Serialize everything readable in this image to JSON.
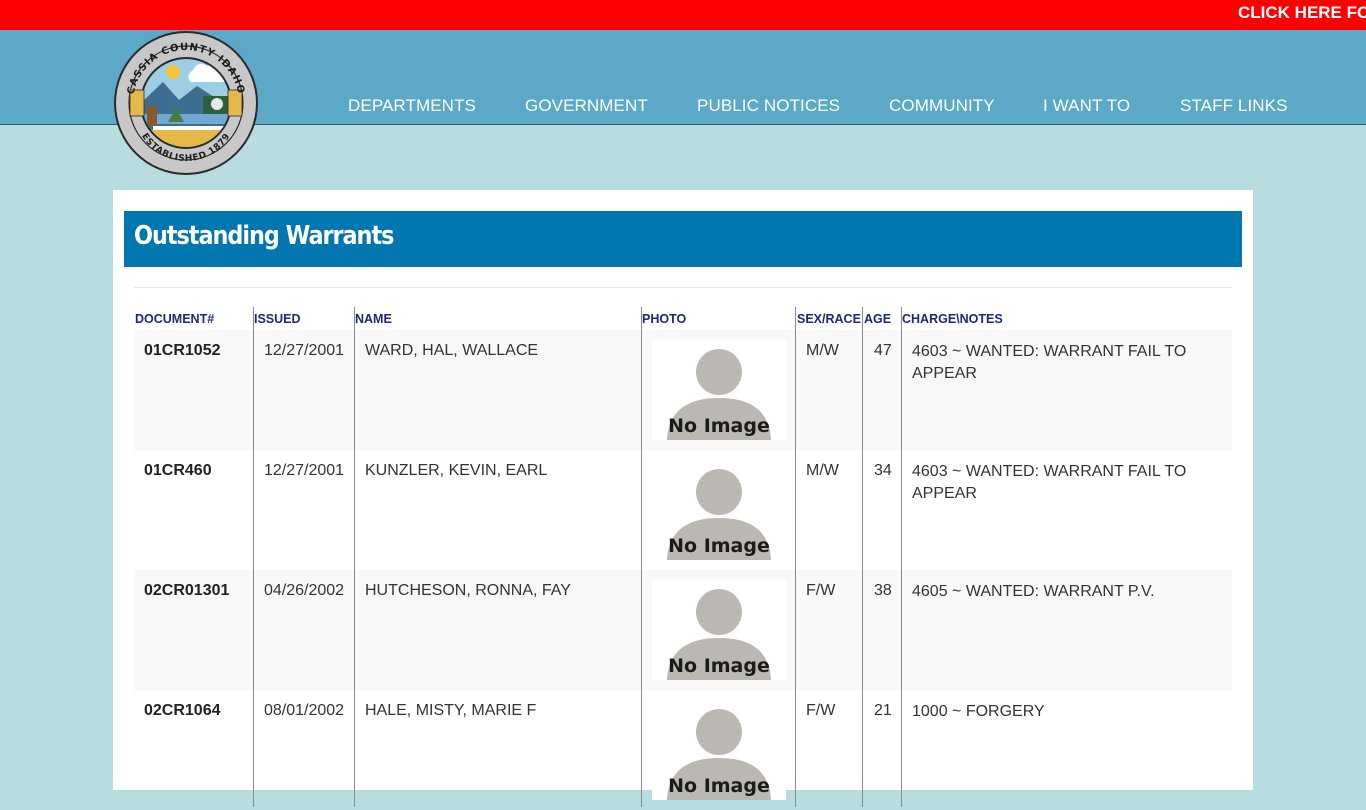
{
  "alert": {
    "text": "CLICK HERE FC"
  },
  "header": {
    "seal": {
      "top": "CASSIA COUNTY IDAHO",
      "bottom": "ESTABLISHED 1879"
    },
    "nav": [
      "DEPARTMENTS",
      "GOVERNMENT",
      "PUBLIC NOTICES",
      "COMMUNITY",
      "I WANT TO",
      "STAFF LINKS"
    ]
  },
  "page": {
    "title": "Outstanding Warrants"
  },
  "table": {
    "columns": [
      "DOCUMENT#",
      "ISSUED",
      "NAME",
      "PHOTO",
      "SEX/RACE",
      "AGE",
      "CHARGE\\NOTES"
    ],
    "photo_placeholder": "No Image",
    "rows": [
      {
        "doc": "01CR1052",
        "issued": "12/27/2001",
        "name": "WARD, HAL, WALLACE",
        "sexrace": "M/W",
        "age": "47",
        "charge": "4603 ~ WANTED: WARRANT FAIL TO APPEAR"
      },
      {
        "doc": "01CR460",
        "issued": "12/27/2001",
        "name": "KUNZLER, KEVIN, EARL",
        "sexrace": "M/W",
        "age": "34",
        "charge": "4603 ~ WANTED: WARRANT FAIL TO APPEAR"
      },
      {
        "doc": "02CR01301",
        "issued": "04/26/2002",
        "name": "HUTCHESON, RONNA, FAY",
        "sexrace": "F/W",
        "age": "38",
        "charge": "4605 ~ WANTED: WARRANT P.V."
      },
      {
        "doc": "02CR1064",
        "issued": "08/01/2002",
        "name": "HALE, MISTY, MARIE F",
        "sexrace": "F/W",
        "age": "21",
        "charge": "1000 ~ FORGERY"
      }
    ]
  }
}
